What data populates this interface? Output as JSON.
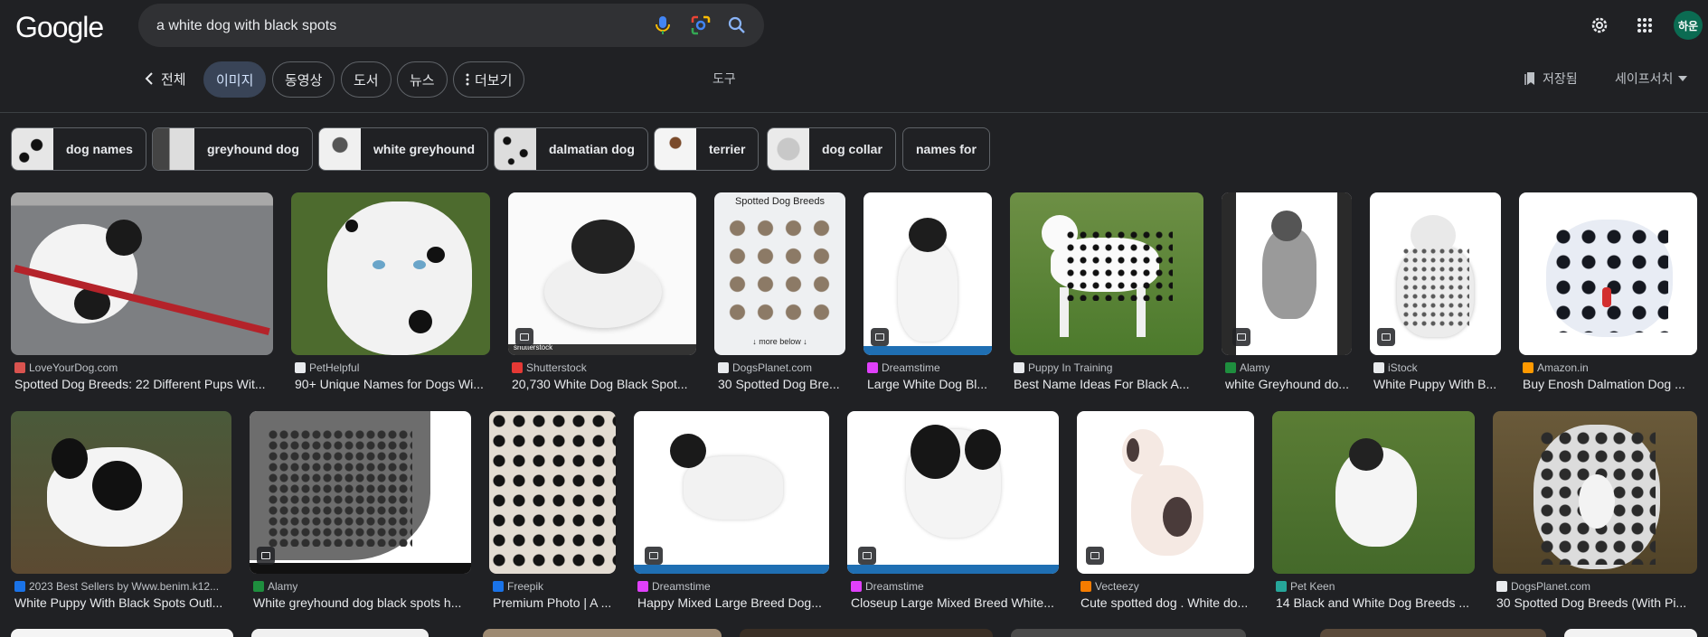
{
  "header": {
    "logo": "Google",
    "search_query": "a white dog with black spots",
    "avatar_initials": "하운"
  },
  "tabs": {
    "all_label": "전체",
    "items": [
      {
        "label": "이미지",
        "active": true
      },
      {
        "label": "동영상",
        "active": false
      },
      {
        "label": "도서",
        "active": false
      },
      {
        "label": "뉴스",
        "active": false
      },
      {
        "label": "더보기",
        "active": false
      }
    ],
    "tools_label": "도구",
    "saved_label": "저장됨",
    "safesearch_label": "세이프서치"
  },
  "related_searches": [
    {
      "label": "dog names"
    },
    {
      "label": "greyhound dog"
    },
    {
      "label": "white greyhound"
    },
    {
      "label": "dalmatian dog"
    },
    {
      "label": "terrier"
    },
    {
      "label": "dog collar"
    },
    {
      "label": "names for"
    }
  ],
  "results_row1": [
    {
      "source": "LoveYourDog.com",
      "title": "Spotted Dog Breeds: 22 Different Pups Wit..."
    },
    {
      "source": "PetHelpful",
      "title": "90+ Unique Names for Dogs Wi..."
    },
    {
      "source": "Shutterstock",
      "title": "20,730 White Dog Black Spot..."
    },
    {
      "source": "DogsPlanet.com",
      "title": "30 Spotted Dog Bre..."
    },
    {
      "source": "Dreamstime",
      "title": "Large White Dog Bl..."
    },
    {
      "source": "Puppy In Training",
      "title": "Best Name Ideas For Black A..."
    },
    {
      "source": "Alamy",
      "title": "white Greyhound do..."
    },
    {
      "source": "iStock",
      "title": "White Puppy With B..."
    },
    {
      "source": "Amazon.in",
      "title": "Buy Enosh Dalmation Dog ..."
    }
  ],
  "results_row2": [
    {
      "source": "2023 Best Sellers by Www.benim.k12...",
      "title": "White Puppy With Black Spots Outl..."
    },
    {
      "source": "Alamy",
      "title": "White greyhound dog black spots h..."
    },
    {
      "source": "Freepik",
      "title": "Premium Photo | A ..."
    },
    {
      "source": "Dreamstime",
      "title": "Happy Mixed Large Breed Dog..."
    },
    {
      "source": "Dreamstime",
      "title": "Closeup Large Mixed Breed White..."
    },
    {
      "source": "Vecteezy",
      "title": "Cute spotted dog . White do..."
    },
    {
      "source": "Pet Keen",
      "title": "14 Black and White Dog Breeds ..."
    },
    {
      "source": "DogsPlanet.com",
      "title": "30 Spotted Dog Breeds (With Pi..."
    }
  ],
  "image_texts": {
    "infographic_title": "Spotted Dog Breeds",
    "infographic_more": "↓ more below ↓",
    "watermark": "shutterstock"
  },
  "colors": {
    "background": "#202124",
    "searchbox": "#303134",
    "active_tab": "#394457",
    "avatar": "#0b6b52"
  }
}
